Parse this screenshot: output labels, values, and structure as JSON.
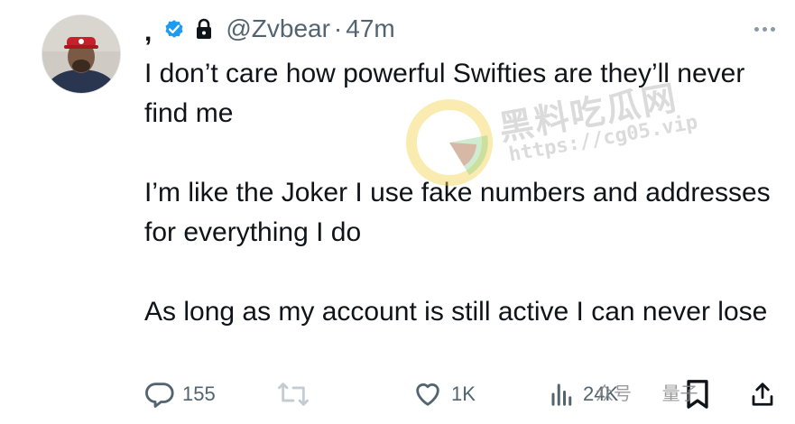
{
  "tweet": {
    "display_name": ",",
    "handle": "@Zvbear",
    "separator": "·",
    "time": "47m",
    "paragraphs": [
      "I don’t care how powerful Swifties are they’ll never find me",
      "I’m like the Joker I use fake numbers and addresses for everything I do",
      "As long as my account is still active I can never lose"
    ]
  },
  "actions": {
    "replies": "155",
    "likes": "1K",
    "views": "24K"
  },
  "icons": [
    "verified-icon",
    "lock-icon",
    "more-icon",
    "reply-icon",
    "retweet-icon",
    "like-icon",
    "views-icon",
    "bookmark-icon",
    "share-icon"
  ],
  "watermark": {
    "title": "黑料吃瓜网",
    "url": "https://cg05.vip",
    "footer": "众号",
    "footer2": "量子"
  },
  "colors": {
    "verified": "#1d9bf0",
    "secondary_text": "#536471",
    "text": "#0f1419"
  }
}
